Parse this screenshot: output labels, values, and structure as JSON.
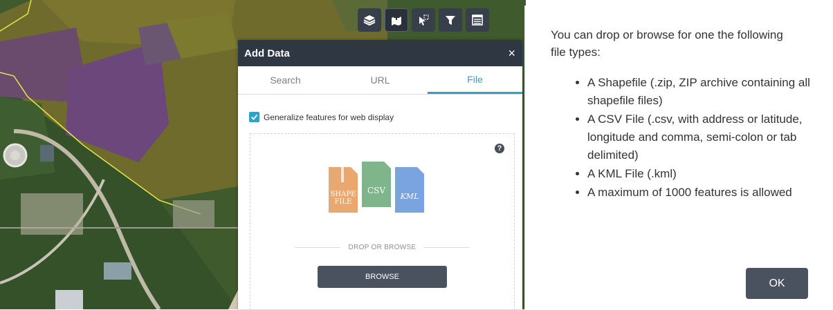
{
  "toolbar": {
    "buttons": [
      {
        "icon": "layers-icon"
      },
      {
        "icon": "add-data-icon"
      },
      {
        "icon": "select-icon"
      },
      {
        "icon": "filter-icon"
      },
      {
        "icon": "attribute-table-icon"
      }
    ]
  },
  "panel": {
    "title": "Add Data",
    "close": "×",
    "tabs": [
      "Search",
      "URL",
      "File"
    ],
    "active_tab": "File",
    "generalize_label": "Generalize features for web display",
    "generalize_checked": true,
    "help": "?",
    "file_icons": {
      "shape_line1": "SHAPE",
      "shape_line2": "FILE",
      "csv": "CSV",
      "kml": "KML"
    },
    "drop_text": "DROP OR BROWSE",
    "browse_label": "BROWSE"
  },
  "dialog": {
    "intro": "You can drop or browse for one the following file types:",
    "items": [
      "A Shapefile (.zip, ZIP archive containing all shapefile files)",
      "A CSV File (.csv, with address or latitude, longitude and comma, semi-colon or tab delimited)",
      "A KML File (.kml)",
      "A maximum of 1000 features is allowed"
    ],
    "ok_label": "OK"
  },
  "colors": {
    "accent": "#2ea3c7",
    "toolbar_bg": "#373f4b",
    "header_bg": "#2f3742",
    "button_bg": "#4a5260",
    "shapefile_icon": "#e8a870",
    "csv_icon": "#7fb58a",
    "kml_icon": "#7aa4e0"
  }
}
